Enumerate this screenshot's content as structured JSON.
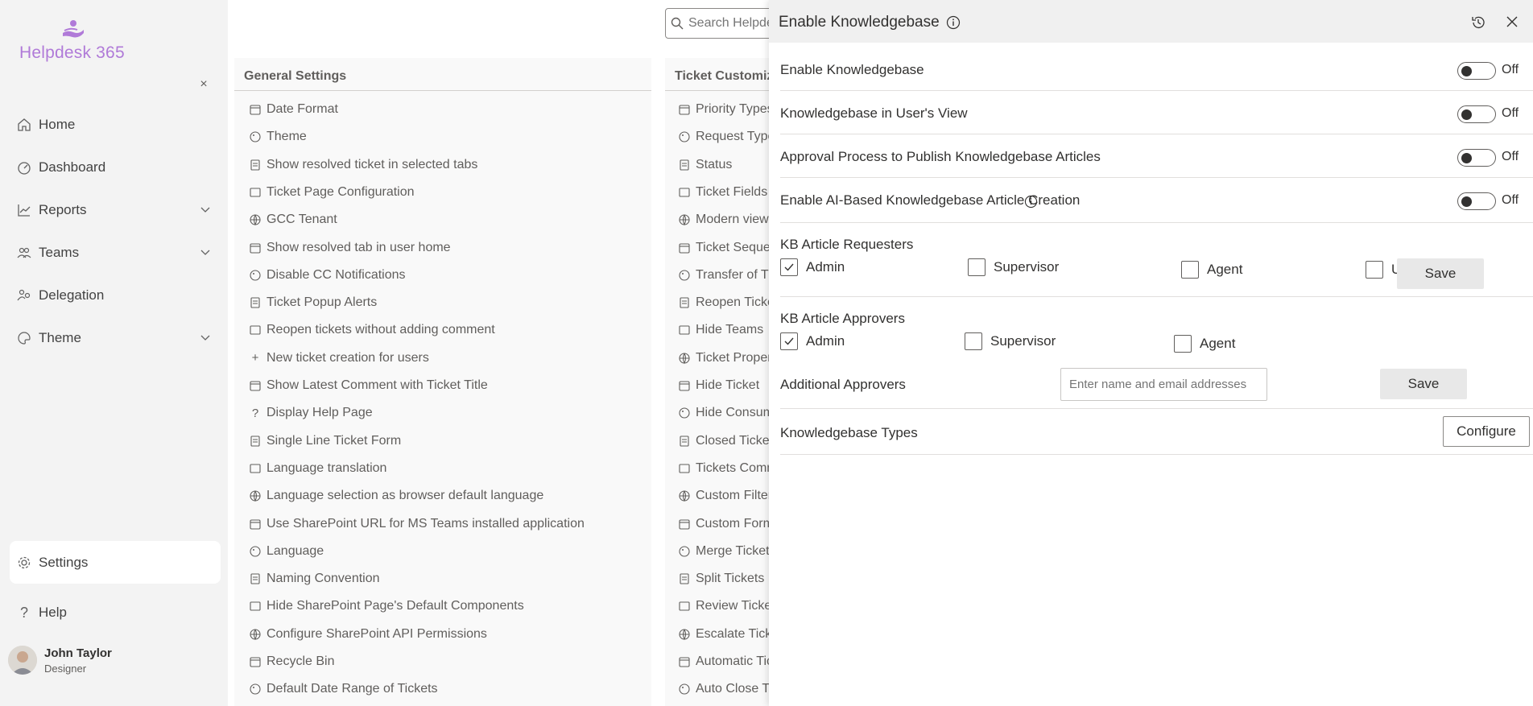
{
  "app": {
    "name": "Helpdesk 365",
    "brand_color": "#b07ad8"
  },
  "sidebar": {
    "collapse_label": "×",
    "items": [
      {
        "label": "Home",
        "icon": "home-icon"
      },
      {
        "label": "Dashboard",
        "icon": "dashboard-icon"
      },
      {
        "label": "Reports",
        "icon": "reports-icon",
        "expandable": true
      },
      {
        "label": "Teams",
        "icon": "teams-icon",
        "expandable": true
      },
      {
        "label": "Delegation",
        "icon": "delegation-icon"
      },
      {
        "label": "Theme",
        "icon": "theme-icon",
        "expandable": true
      },
      {
        "label": "Settings",
        "icon": "gear-icon",
        "active": true
      },
      {
        "label": "Help",
        "icon": "help-icon"
      }
    ],
    "user": {
      "name": "John Taylor",
      "role": "Designer"
    }
  },
  "search": {
    "placeholder": "Search Helpdesk"
  },
  "general_settings": {
    "title": "General Settings",
    "items": [
      "Date Format",
      "Theme",
      "Show resolved ticket in selected tabs",
      "Ticket Page Configuration",
      "GCC Tenant",
      "Show resolved tab in user home",
      "Disable CC Notifications",
      "Ticket Popup Alerts",
      "Reopen tickets without adding comment",
      "New ticket creation for users",
      "Show Latest Comment with Ticket Title",
      "Display Help Page",
      "Single Line Ticket Form",
      "Language translation",
      "Language selection as browser default language",
      "Use SharePoint URL for MS Teams installed application",
      "Language",
      "Naming Convention",
      "Hide SharePoint Page's Default Components",
      "Configure SharePoint API Permissions",
      "Recycle Bin",
      "Default Date Range of Tickets"
    ]
  },
  "ticket_customization": {
    "title": "Ticket Customization",
    "items": [
      "Priority Types",
      "Request Types",
      "Status",
      "Ticket Fields",
      "Modern view",
      "Ticket Sequence",
      "Transfer of Tickets",
      "Reopen Tickets",
      "Hide Teams",
      "Ticket Properties",
      "Hide Ticket",
      "Hide Consumer",
      "Closed Tickets",
      "Tickets Comments",
      "Custom Filters",
      "Custom Forms",
      "Merge Tickets",
      "Split Tickets",
      "Review Tickets",
      "Escalate Tickets",
      "Automatic Tickets",
      "Auto Close Tickets"
    ]
  },
  "drawer": {
    "title": "Enable Knowledgebase",
    "toggles": [
      {
        "label": "Enable Knowledgebase",
        "state": "Off"
      },
      {
        "label": "Knowledgebase in User's View",
        "state": "Off"
      },
      {
        "label": "Approval Process to Publish Knowledgebase Articles",
        "state": "Off"
      },
      {
        "label": "Enable AI-Based Knowledgebase Article Creation",
        "state": "Off",
        "info": true
      }
    ],
    "requesters": {
      "label": "KB Article Requesters",
      "options": [
        {
          "label": "Admin",
          "checked": true
        },
        {
          "label": "Supervisor",
          "checked": false
        },
        {
          "label": "Agent",
          "checked": false
        },
        {
          "label": "User",
          "checked": false
        }
      ],
      "save_label": "Save"
    },
    "approvers": {
      "label": "KB Article Approvers",
      "options": [
        {
          "label": "Admin",
          "checked": true
        },
        {
          "label": "Supervisor",
          "checked": false
        },
        {
          "label": "Agent",
          "checked": false
        }
      ],
      "additional_label": "Additional Approvers",
      "input_placeholder": "Enter name and email addresses",
      "save_label": "Save"
    },
    "types": {
      "label": "Knowledgebase Types",
      "button_label": "Configure"
    }
  }
}
